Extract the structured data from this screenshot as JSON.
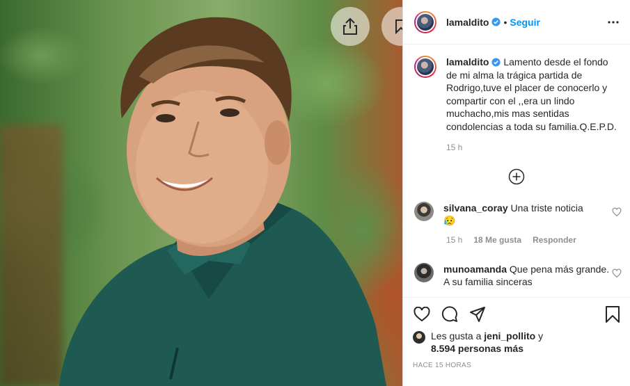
{
  "post": {
    "username": "lamaldito",
    "follow_label": "Seguir",
    "dot": "•"
  },
  "caption": {
    "username": "lamaldito",
    "text": "Lamento desde el fondo de mi alma la trágica partida de Rodrigo,tuve el placer de conocerlo y compartir con el ,,era un lindo muchacho,mis mas sentidas condolencias a toda su familia.Q.E.P.D.",
    "time": "15 h"
  },
  "comments": [
    {
      "username": "silvana_coray",
      "text": "Una triste noticia",
      "emoji": "😥",
      "time": "15 h",
      "likes": "18 Me gusta",
      "reply": "Responder"
    },
    {
      "username": "munoamanda",
      "text": "Que pena más grande. A su familia sinceras"
    }
  ],
  "likes": {
    "prefix": "Les gusta a",
    "user": "jeni_pollito",
    "and": "y",
    "others": "8.594 personas más"
  },
  "posted": "HACE 15 HORAS",
  "colors": {
    "link": "#0095f6",
    "verified": "#3897f0",
    "muted": "#8e8e8e",
    "text": "#262626"
  },
  "icons": [
    "share-icon",
    "bookmark-icon",
    "verified-badge-icon",
    "more-options-icon",
    "load-more-icon",
    "heart-icon",
    "comment-icon",
    "send-icon"
  ]
}
